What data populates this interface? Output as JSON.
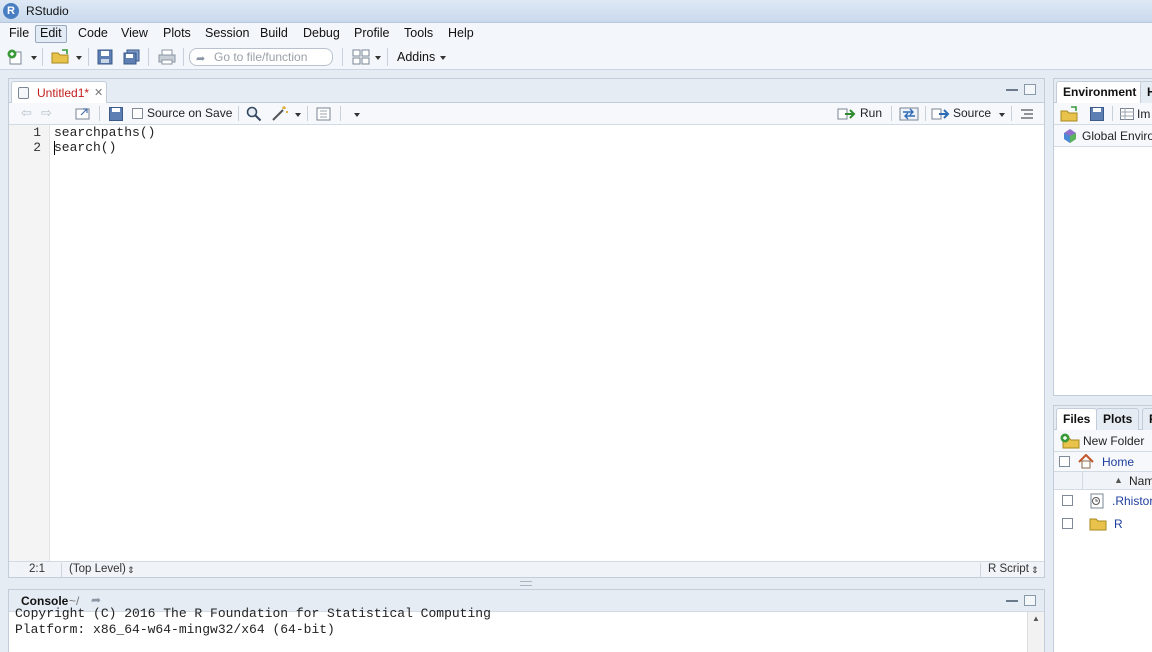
{
  "app": {
    "title": "RStudio",
    "logo_letter": "R"
  },
  "menu": [
    "File",
    "Edit",
    "Code",
    "View",
    "Plots",
    "Session",
    "Build",
    "Debug",
    "Profile",
    "Tools",
    "Help"
  ],
  "toolbar": {
    "goto_placeholder": "Go to file/function",
    "addins_label": "Addins"
  },
  "editor": {
    "tab_label": "Untitled1*",
    "source_on_save_label": "Source on Save",
    "run_label": "Run",
    "source_label": "Source",
    "lines": [
      {
        "num": "1",
        "text": "searchpaths()"
      },
      {
        "num": "2",
        "text": "search()"
      }
    ],
    "status": {
      "position": "2:1",
      "scope": "(Top Level)",
      "filetype": "R Script"
    }
  },
  "console": {
    "title": "Console",
    "path": "~/",
    "lines": [
      "Copyright (C) 2016 The R Foundation for Statistical Computing",
      "Platform: x86_64-w64-mingw32/x64 (64-bit)"
    ]
  },
  "environment": {
    "tabs": [
      "Environment",
      "H"
    ],
    "import_label": "Im",
    "scope_label": "Global Environ"
  },
  "files": {
    "tabs": [
      "Files",
      "Plots",
      "P"
    ],
    "new_folder_label": "New Folder",
    "home_label": "Home",
    "name_header": "Nam",
    "items": [
      ".Rhistor",
      "R"
    ]
  }
}
